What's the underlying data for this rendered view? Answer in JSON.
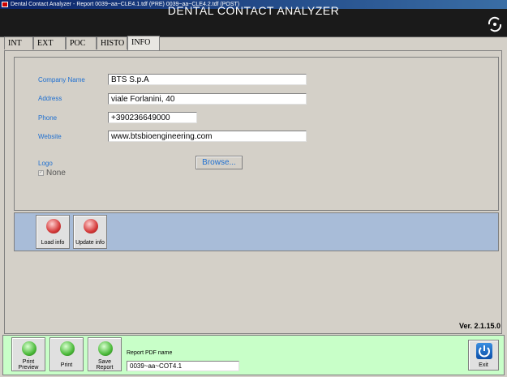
{
  "window": {
    "title": "Dental Contact Analyzer - Report  0039~aa~CLE4.1.tdf (PRE)  0039~aa~CLE4.2.tdf (POST)",
    "app_title": "DENTAL CONTACT ANALYZER"
  },
  "tabs": [
    {
      "label": "INT"
    },
    {
      "label": "EXT"
    },
    {
      "label": "POC"
    },
    {
      "label": "HISTO"
    },
    {
      "label": "INFO"
    }
  ],
  "info": {
    "company_label": "Company Name",
    "company_value": "BTS S.p.A",
    "address_label": "Address",
    "address_value": "viale Forlanini, 40",
    "phone_label": "Phone",
    "phone_value": "+390236649000",
    "website_label": "Website",
    "website_value": "www.btsbioengineering.com",
    "logo_label": "Logo",
    "logo_none_label": "None",
    "logo_none_checked": true,
    "browse_label": "Browse..."
  },
  "actions": {
    "load_info_label": "Load info",
    "update_info_label": "Update info"
  },
  "version": "Ver. 2.1.15.0",
  "bottom": {
    "print_preview_label_1": "Print",
    "print_preview_label_2": "Preview",
    "print_label": "Print",
    "save_report_label_1": "Save",
    "save_report_label_2": "Report",
    "pdf_name_label": "Report PDF name",
    "pdf_name_value": "0039~aa~COT4.1",
    "exit_label": "Exit"
  },
  "colors": {
    "label_blue": "#2070d0",
    "action_bar": "#a8bcd8",
    "bottom_bar": "#c8ffc8",
    "header_bg": "#1a1a1a"
  }
}
